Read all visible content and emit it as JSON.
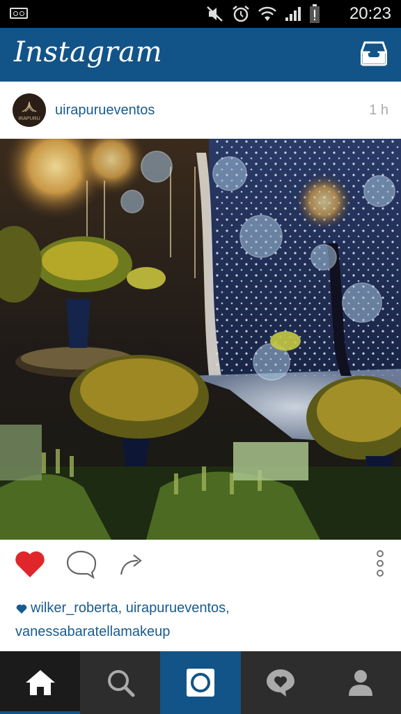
{
  "status_bar": {
    "time": "20:23",
    "icons": [
      "voicemail-icon",
      "mute-icon",
      "alarm-icon",
      "wifi-icon",
      "signal-icon",
      "battery-icon"
    ]
  },
  "header": {
    "logo": "Instagram",
    "inbox_icon": "inbox-icon",
    "color": "#135488"
  },
  "post": {
    "avatar_text": "IRAPURU",
    "username": "uirapurueventos",
    "time_ago": "1 h",
    "liked": true,
    "likes_line1": "wilker_roberta, uirapurueventos,",
    "likes_line2": "vanessabaratellamakeup"
  },
  "actions": [
    "like-icon",
    "comment-icon",
    "share-icon",
    "more-options-icon"
  ],
  "nav": [
    "home-icon",
    "search-icon",
    "camera-icon",
    "activity-icon",
    "profile-icon"
  ],
  "colors": {
    "accent": "#135488",
    "like": "#e0262b",
    "link": "#185b8f"
  }
}
